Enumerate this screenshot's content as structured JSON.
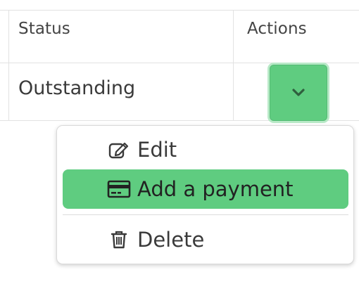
{
  "table": {
    "headers": {
      "status": "Status",
      "actions": "Actions"
    },
    "row": {
      "status": "Outstanding"
    }
  },
  "actions_button": {
    "icon": "chevron-down-icon"
  },
  "menu": {
    "items": [
      {
        "label": "Edit",
        "icon": "edit-icon"
      },
      {
        "label": "Add a payment",
        "icon": "credit-card-icon"
      },
      {
        "label": "Delete",
        "icon": "trash-icon"
      }
    ]
  },
  "colors": {
    "accent": "#5fcc80",
    "accent_ring": "#b8e9c7",
    "border": "#e2e2e2"
  }
}
